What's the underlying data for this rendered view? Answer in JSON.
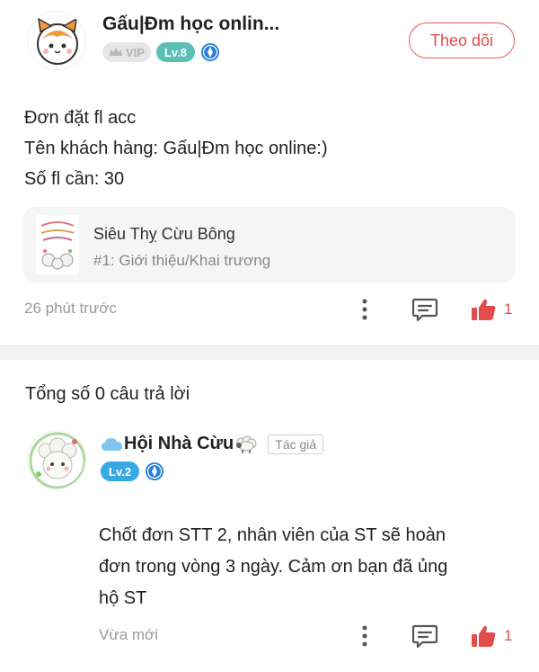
{
  "post": {
    "author_name": "Gấu|Đm học onlin...",
    "vip_label": "VIP",
    "level_label": "Lv.8",
    "follow_label": "Theo dõi",
    "body_lines": [
      "Đơn đặt fl acc",
      "Tên khách hàng: Gấu|Đm  học online:)",
      "Số fl cần: 30"
    ],
    "group": {
      "name": "Siêu Thỵ Cừu Bông",
      "topic": "#1: Giới thiệu/Khai trương"
    },
    "timestamp": "26 phút trước",
    "like_count": "1"
  },
  "answers": {
    "title": "Tổng số 0 câu trả lời"
  },
  "reply": {
    "author_name": "Hội Nhà Cừu",
    "author_tag": "Tác giả",
    "level_label": "Lv.2",
    "body_lines": [
      "Chốt đơn STT 2, nhân viên của ST sẽ hoàn",
      "đơn trong vòng 3 ngày. Cảm ơn bạn đã ủng",
      "hộ ST"
    ],
    "timestamp": "Vừa mới",
    "like_count": "1"
  },
  "colors": {
    "accent_red": "#e24c4c",
    "level8": "#5bbfb5",
    "level2": "#39a9e6",
    "verify_blue": "#2a7fd4"
  }
}
